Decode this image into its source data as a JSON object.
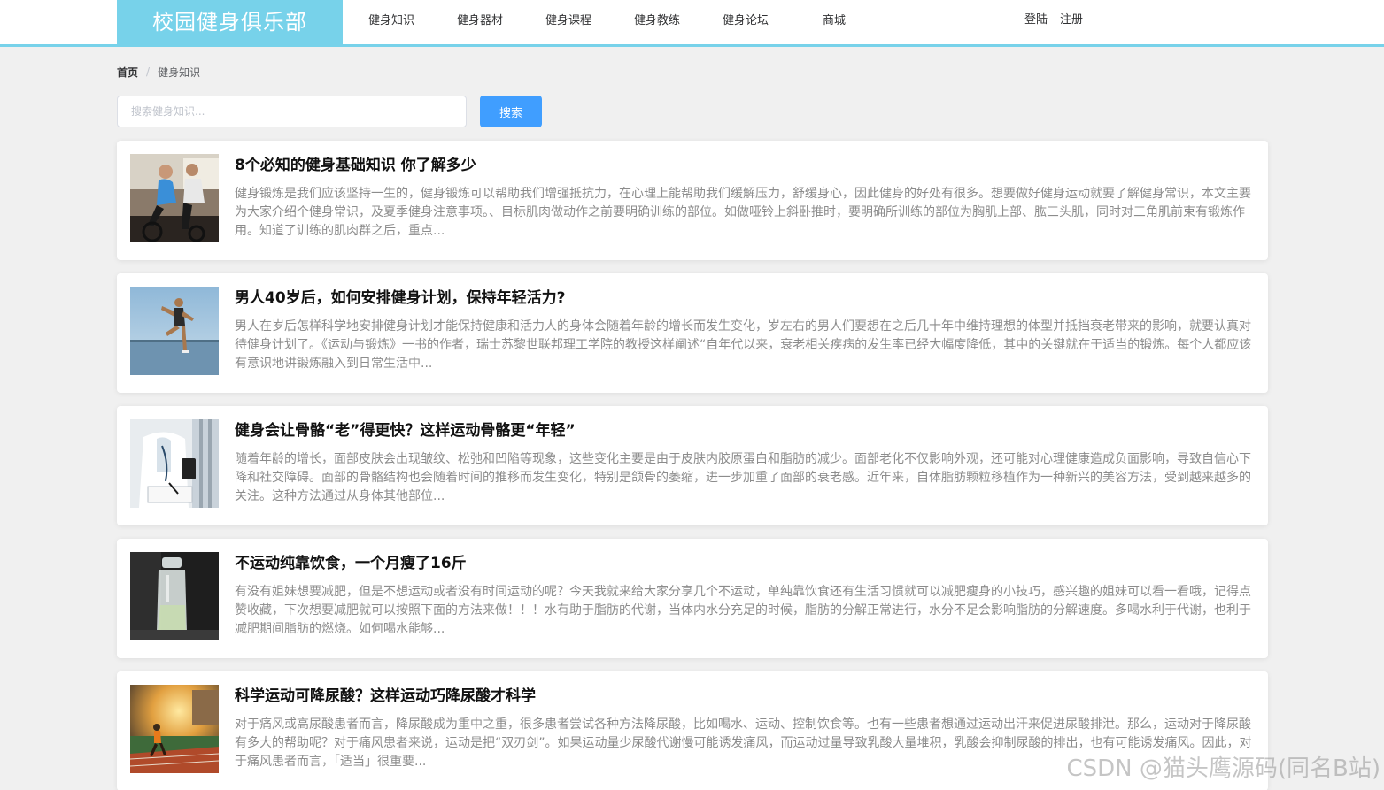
{
  "header": {
    "logo": "校园健身俱乐部",
    "nav": [
      "健身知识",
      "健身器材",
      "健身课程",
      "健身教练",
      "健身论坛",
      "商城"
    ],
    "login": "登陆",
    "register": "注册"
  },
  "breadcrumb": {
    "home": "首页",
    "separator": "/",
    "current": "健身知识"
  },
  "search": {
    "placeholder": "搜索健身知识...",
    "value": "",
    "button": "搜索"
  },
  "articles": [
    {
      "title": "8个必知的健身基础知识 你了解多少",
      "desc": "健身锻炼是我们应该坚持一生的，健身锻炼可以帮助我们增强抵抗力，在心理上能帮助我们缓解压力，舒缓身心，因此健身的好处有很多。想要做好健身运动就要了解健身常识，本文主要为大家介绍个健身常识，及夏季健身注意事项。、目标肌肉做动作之前要明确训练的部位。如做哑铃上斜卧推时，要明确所训练的部位为胸肌上部、肱三头肌，同时对三角肌前束有锻炼作用。知道了训练的肌肉群之后，重点...",
      "image": "gym-cycling-photo"
    },
    {
      "title": "男人40岁后，如何安排健身计划，保持年轻活力?",
      "desc": "男人在岁后怎样科学地安排健身计划才能保持健康和活力人的身体会随着年龄的增长而发生变化，岁左右的男人们要想在之后几十年中维持理想的体型并抵挡衰老带来的影响，就要认真对待健身计划了。《运动与锻炼》一书的作者，瑞士苏黎世联邦理工学院的教授这样阐述“自年代以来，衰老相关疾病的发生率已经大幅度降低，其中的关键就在于适当的锻炼。每个人都应该有意识地讲锻炼融入到日常生活中...",
      "image": "runner-lakeside-photo"
    },
    {
      "title": "健身会让骨骼“老”得更快？这样运动骨骼更“年轻”",
      "desc": "随着年龄的增长，面部皮肤会出现皱纹、松弛和凹陷等现象，这些变化主要是由于皮肤内胶原蛋白和脂肪的减少。面部老化不仅影响外观，还可能对心理健康造成负面影响，导致自信心下降和社交障碍。面部的骨骼结构也会随着时间的推移而发生变化，特别是颌骨的萎缩，进一步加重了面部的衰老感。近年来，自体脂肪颗粒移植作为一种新兴的美容方法，受到越来越多的关注。这种方法通过从身体其他部位...",
      "image": "doctor-writing-photo"
    },
    {
      "title": "不运动纯靠饮食，一个月瘦了16斤",
      "desc": "有没有姐妹想要减肥，但是不想运动或者没有时间运动的呢？今天我就来给大家分享几个不运动，单纯靠饮食还有生活习惯就可以减肥瘦身的小技巧，感兴趣的姐妹可以看一看哦，记得点赞收藏，下次想要减肥就可以按照下面的方法来做！！！水有助于脂肪的代谢，当体内水分充足的时候，脂肪的分解正常进行，水分不足会影响脂肪的分解速度。多喝水利于代谢，也利于减肥期间脂肪的燃烧。如何喝水能够...",
      "image": "water-bottle-photo"
    },
    {
      "title": "科学运动可降尿酸？这样运动巧降尿酸才科学",
      "desc": "对于痛风或高尿酸患者而言，降尿酸成为重中之重，很多患者尝试各种方法降尿酸，比如喝水、运动、控制饮食等。也有一些患者想通过运动出汗来促进尿酸排泄。那么，运动对于降尿酸有多大的帮助呢？对于痛风患者来说，运动是把“双刃剑”。如果运动量少尿酸代谢慢可能诱发痛风，而运动过量导致乳酸大量堆积，乳酸会抑制尿酸的排出，也有可能诱发痛风。因此，对于痛风患者而言，「适当」很重要...",
      "image": "track-runner-photo"
    }
  ],
  "watermark": "CSDN @猫头鹰源码(同名B站)"
}
